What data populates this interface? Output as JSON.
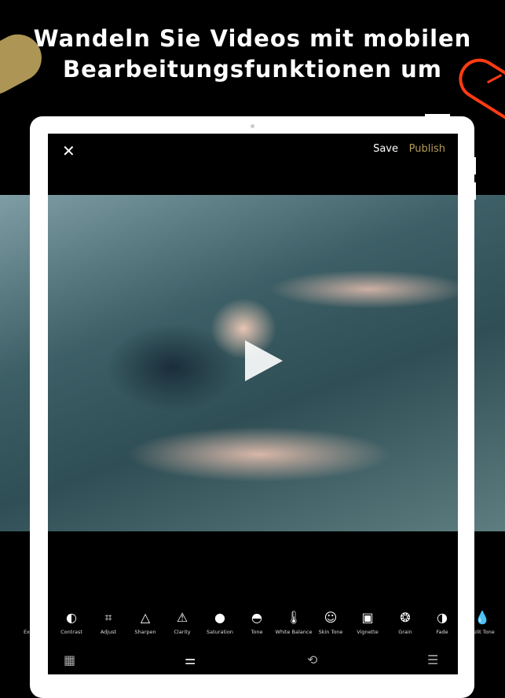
{
  "headline": {
    "line1": "Wandeln Sie Videos mit mobilen",
    "line2": "Bearbeitungsfunktionen um"
  },
  "colors": {
    "accent_gold": "#b49c5a",
    "accent_orange": "#ff3b14"
  },
  "editor": {
    "close_icon": "close-icon",
    "save_label": "Save",
    "publish_label": "Publish",
    "play_icon": "play-icon"
  },
  "tools": [
    {
      "label": "Exposure",
      "visible_label": "Ex",
      "icon": "◐"
    },
    {
      "label": "Contrast",
      "icon": "◐"
    },
    {
      "label": "Adjust",
      "icon": "⌗"
    },
    {
      "label": "Sharpen",
      "icon": "△"
    },
    {
      "label": "Clarity",
      "icon": "⚠"
    },
    {
      "label": "Saturation",
      "icon": "●"
    },
    {
      "label": "Tone",
      "icon": "◓"
    },
    {
      "label": "White Balance",
      "icon": "🌡"
    },
    {
      "label": "Skin Tone",
      "icon": "☺"
    },
    {
      "label": "Vignette",
      "icon": "▣"
    },
    {
      "label": "Grain",
      "icon": "❂"
    },
    {
      "label": "Fade",
      "icon": "◑"
    },
    {
      "label": "Split Tone",
      "visible_label": "lit Tone",
      "icon": "💧"
    }
  ],
  "bottom_nav": [
    {
      "name": "presets-grid",
      "icon": "▦"
    },
    {
      "name": "tools-sliders",
      "icon": "⚌"
    },
    {
      "name": "history",
      "icon": "⟲"
    },
    {
      "name": "recipes",
      "icon": "☰"
    }
  ]
}
